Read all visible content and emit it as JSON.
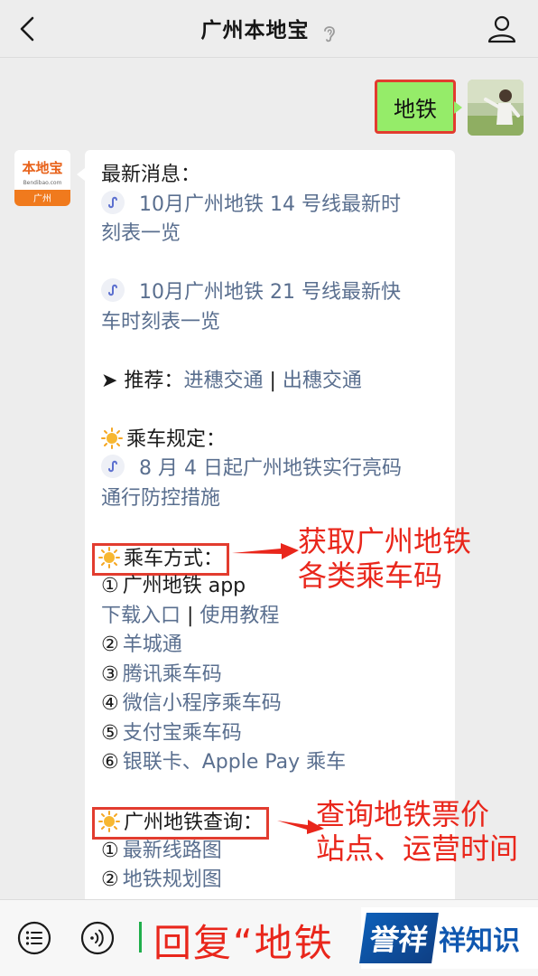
{
  "header": {
    "title": "广州本地宝"
  },
  "outgoing": {
    "text": "地铁"
  },
  "avatar_logo": {
    "line1": "本地宝",
    "line2": "Bendibao.com",
    "line3": "广州"
  },
  "message": {
    "latest_label": "最新消息：",
    "news1_line1": "10月广州地铁 14 号线最新时",
    "news1_line2": "刻表一览",
    "news2_line1": "10月广州地铁 21 号线最新快",
    "news2_line2": "车时刻表一览",
    "recommend_prefix": "➤ 推荐：",
    "recommend_link1": "进穗交通",
    "recommend_sep": " | ",
    "recommend_link2": "出穗交通",
    "rules_label": "乘车规定：",
    "rules_line1": "8 月 4 日起广州地铁实行亮码",
    "rules_line2": "通行防控措施",
    "ride_label": "乘车方式：",
    "ride_item1_num": "①",
    "ride_item1": "广州地铁 app",
    "ride_item1_link1": "下载入口",
    "ride_item1_sep": " | ",
    "ride_item1_link2": "使用教程",
    "ride_item2_num": "②",
    "ride_item2": "羊城通",
    "ride_item3_num": "③",
    "ride_item3": "腾讯乘车码",
    "ride_item4_num": "④",
    "ride_item4": "微信小程序乘车码",
    "ride_item5_num": "⑤",
    "ride_item5": "支付宝乘车码",
    "ride_item6_num": "⑥",
    "ride_item6": "银联卡、Apple Pay 乘车",
    "query_label": "广州地铁查询：",
    "query_item1_num": "①",
    "query_item1": "最新线路图",
    "query_item2_num": "②",
    "query_item2": "地铁规划图"
  },
  "annotations": {
    "a1_line1": "获取广州地铁",
    "a1_line2": "各类乘车码",
    "a2_line1": "查询地铁票价",
    "a2_line2": "站点、运营时间"
  },
  "bottom": {
    "reply_text": "回复“地铁"
  },
  "watermark": {
    "logo": "誉祥",
    "text": "祥知识"
  },
  "colors": {
    "red": "#e23c2f",
    "green_bubble": "#95ec69",
    "link": "#5a6f8f"
  }
}
